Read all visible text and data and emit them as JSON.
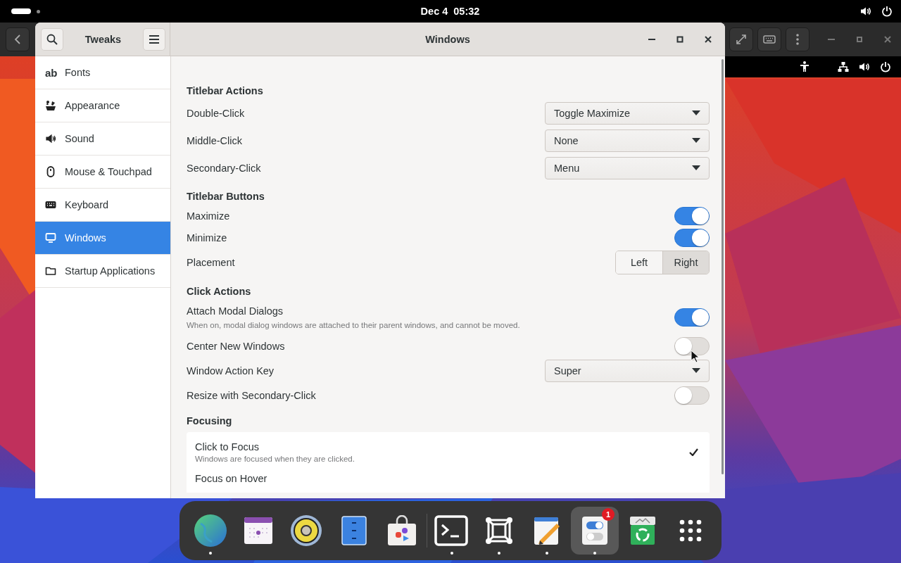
{
  "top_bar": {
    "date": "Dec 4",
    "time": "05:32"
  },
  "window": {
    "sidebar_title": "Tweaks",
    "title": "Windows",
    "sidebar": {
      "items": [
        {
          "label": "Fonts",
          "glyph": "ab",
          "selected": false
        },
        {
          "label": "Appearance",
          "selected": false
        },
        {
          "label": "Sound",
          "selected": false
        },
        {
          "label": "Mouse & Touchpad",
          "selected": false
        },
        {
          "label": "Keyboard",
          "selected": false
        },
        {
          "label": "Windows",
          "selected": true
        },
        {
          "label": "Startup Applications",
          "selected": false
        }
      ]
    },
    "sections": [
      {
        "heading": "Titlebar Actions",
        "rows": [
          {
            "kind": "dropdown",
            "label": "Double-Click",
            "value": "Toggle Maximize"
          },
          {
            "kind": "dropdown",
            "label": "Middle-Click",
            "value": "None"
          },
          {
            "kind": "dropdown",
            "label": "Secondary-Click",
            "value": "Menu"
          }
        ]
      },
      {
        "heading": "Titlebar Buttons",
        "rows": [
          {
            "kind": "switch",
            "label": "Maximize",
            "on": true
          },
          {
            "kind": "switch",
            "label": "Minimize",
            "on": true
          },
          {
            "kind": "segmented",
            "label": "Placement",
            "options": [
              {
                "label": "Left",
                "selected": false
              },
              {
                "label": "Right",
                "selected": true
              }
            ]
          }
        ]
      },
      {
        "heading": "Click Actions",
        "rows": [
          {
            "kind": "switch",
            "label": "Attach Modal Dialogs",
            "description": "When on, modal dialog windows are attached to their parent windows, and cannot be moved.",
            "on": true
          },
          {
            "kind": "switch",
            "label": "Center New Windows",
            "on": false
          },
          {
            "kind": "dropdown",
            "label": "Window Action Key",
            "value": "Super"
          },
          {
            "kind": "switch",
            "label": "Resize with Secondary-Click",
            "on": false
          }
        ]
      },
      {
        "heading": "Focusing",
        "rows": [
          {
            "kind": "choices",
            "items": [
              {
                "label": "Click to Focus",
                "description": "Windows are focused when they are clicked.",
                "selected": true
              },
              {
                "label": "Focus on Hover",
                "selected": false
              }
            ]
          }
        ]
      }
    ]
  },
  "dock": {
    "items": [
      {
        "running": true,
        "selected": false
      },
      {
        "running": false,
        "selected": false
      },
      {
        "running": false,
        "selected": false
      },
      {
        "running": false,
        "selected": false
      },
      {
        "running": false,
        "selected": false
      },
      {
        "running": true,
        "selected": false
      },
      {
        "running": true,
        "selected": false
      },
      {
        "running": true,
        "selected": false
      },
      {
        "running": true,
        "selected": true,
        "badge": "1"
      },
      {
        "running": false,
        "selected": false
      },
      {
        "running": false,
        "selected": false
      }
    ]
  }
}
